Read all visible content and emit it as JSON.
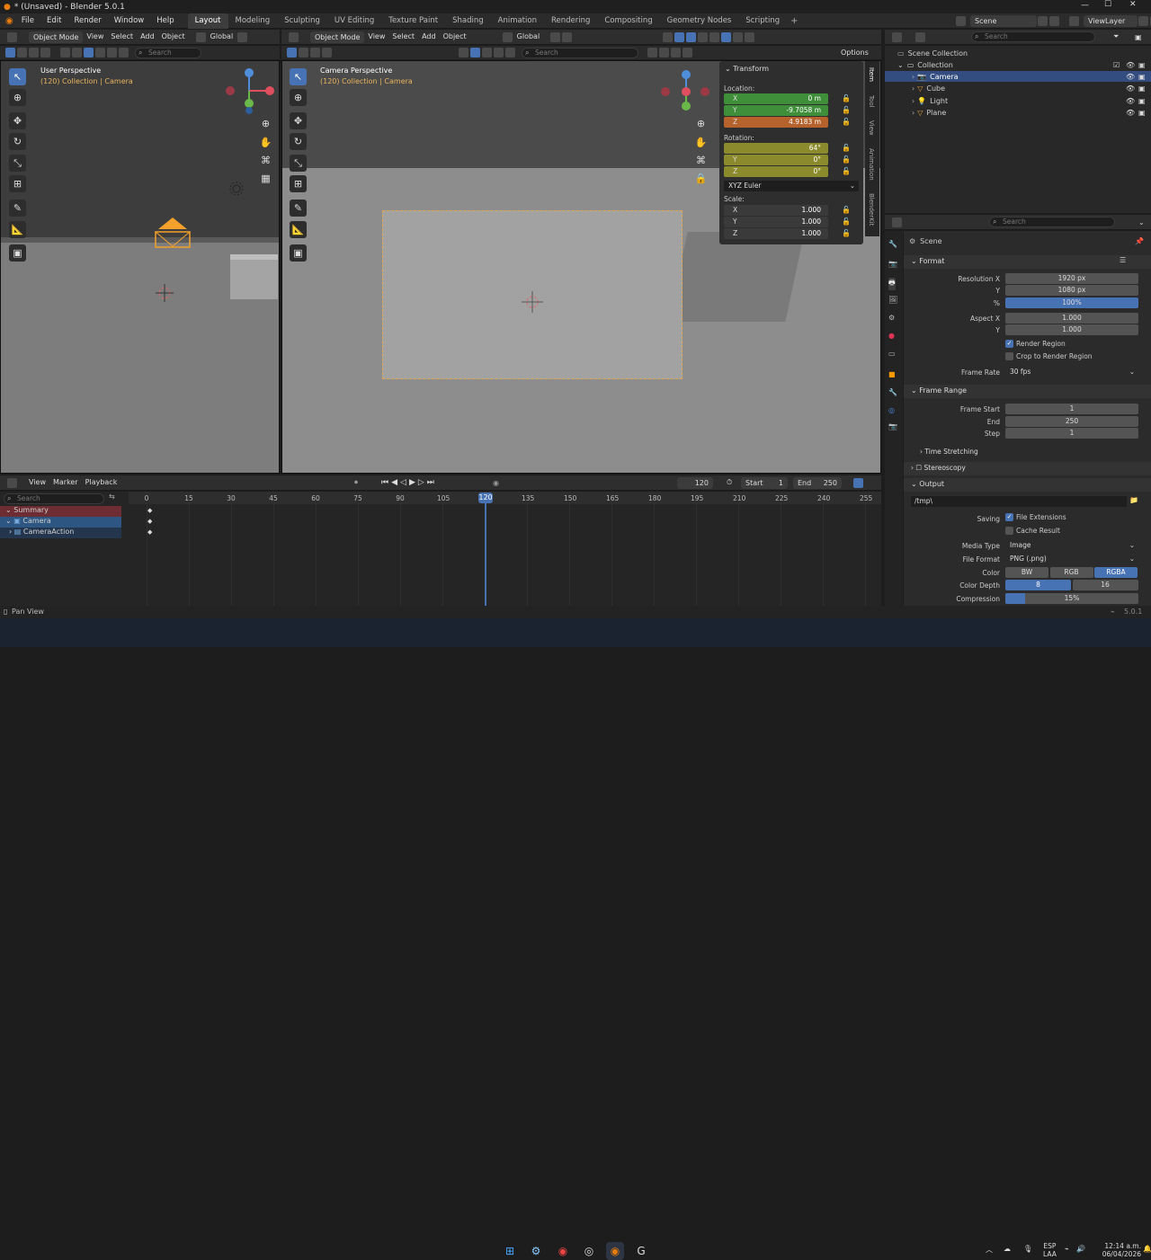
{
  "window": {
    "title": "* (Unsaved) - Blender 5.0.1"
  },
  "menubar": {
    "menus": [
      "File",
      "Edit",
      "Render",
      "Window",
      "Help"
    ],
    "workspaces": [
      "Layout",
      "Modeling",
      "Sculpting",
      "UV Editing",
      "Texture Paint",
      "Shading",
      "Animation",
      "Rendering",
      "Compositing",
      "Geometry Nodes",
      "Scripting"
    ],
    "active_workspace": "Layout",
    "add_tab": "+",
    "scene": "Scene",
    "view_layer": "ViewLayer"
  },
  "viewport_left": {
    "mode": "Object Mode",
    "menus": [
      "View",
      "Select",
      "Add",
      "Object"
    ],
    "orientation": "Global",
    "search_placeholder": "Search",
    "perspective": "User Perspective",
    "collection_line": "(120) Collection | Camera"
  },
  "viewport_right": {
    "mode": "Object Mode",
    "menus": [
      "View",
      "Select",
      "Add",
      "Object"
    ],
    "orientation": "Global",
    "search_placeholder": "Search",
    "perspective": "Camera Perspective",
    "collection_line": "(120) Collection | Camera",
    "options": "Options"
  },
  "npanel": {
    "title": "Transform",
    "location_label": "Location:",
    "location": [
      {
        "axis": "X",
        "value": "0 m"
      },
      {
        "axis": "Y",
        "value": "-9.7058 m"
      },
      {
        "axis": "Z",
        "value": "4.9183 m"
      }
    ],
    "rotation_label": "Rotation:",
    "rotation": [
      {
        "axis": "",
        "value": "64°"
      },
      {
        "axis": "Y",
        "value": "0°"
      },
      {
        "axis": "Z",
        "value": "0°"
      }
    ],
    "rotation_mode": "XYZ Euler",
    "scale_label": "Scale:",
    "scale": [
      {
        "axis": "X",
        "value": "1.000"
      },
      {
        "axis": "Y",
        "value": "1.000"
      },
      {
        "axis": "Z",
        "value": "1.000"
      }
    ],
    "tabs": [
      "Item",
      "Tool",
      "View",
      "Animation",
      "BlenderKit"
    ]
  },
  "outliner": {
    "search_placeholder": "Search",
    "root": "Scene Collection",
    "collection": "Collection",
    "items": [
      "Camera",
      "Cube",
      "Light",
      "Plane"
    ]
  },
  "properties": {
    "search_placeholder": "Search",
    "scene_name": "Scene",
    "format_title": "Format",
    "res_x_label": "Resolution X",
    "res_x": "1920 px",
    "res_y_label": "Y",
    "res_y": "1080 px",
    "res_pct_label": "%",
    "res_pct": "100%",
    "aspect_x_label": "Aspect X",
    "aspect_x": "1.000",
    "aspect_y_label": "Y",
    "aspect_y": "1.000",
    "render_region": "Render Region",
    "crop_region": "Crop to Render Region",
    "frame_rate_label": "Frame Rate",
    "frame_rate": "30 fps",
    "frame_range_title": "Frame Range",
    "frame_start_label": "Frame Start",
    "frame_start": "1",
    "end_label": "End",
    "end": "250",
    "step_label": "Step",
    "step": "1",
    "time_stretching": "Time Stretching",
    "stereoscopy": "Stereoscopy",
    "output_title": "Output",
    "output_path": "/tmp\\",
    "saving_label": "Saving",
    "file_ext": "File Extensions",
    "cache_result": "Cache Result",
    "media_type_label": "Media Type",
    "media_type": "Image",
    "file_format_label": "File Format",
    "file_format": "PNG (.png)",
    "color_label": "Color",
    "color_opts": [
      "BW",
      "RGB",
      "RGBA"
    ],
    "color_depth_label": "Color Depth",
    "depth_opts": [
      "8",
      "16"
    ],
    "compression_label": "Compression",
    "compression": "15%",
    "compression_fraction": 0.15
  },
  "timeline": {
    "menus": [
      "View",
      "Marker",
      "Playback"
    ],
    "current_frame": "120",
    "start_label": "Start",
    "start": "1",
    "end_label": "End",
    "end": "250",
    "search_placeholder": "Search",
    "ticks": [
      "0",
      "15",
      "30",
      "45",
      "60",
      "75",
      "90",
      "105",
      "120",
      "135",
      "150",
      "165",
      "180",
      "195",
      "210",
      "225",
      "240",
      "255"
    ],
    "channels": [
      "Summary",
      "Camera",
      "CameraAction"
    ]
  },
  "statusbar": {
    "left": "Pan View",
    "version": "5.0.1"
  },
  "taskbar": {
    "lang1": "ESP",
    "lang2": "LAA",
    "time": "12:14 a.m.",
    "date": "06/04/2026"
  }
}
